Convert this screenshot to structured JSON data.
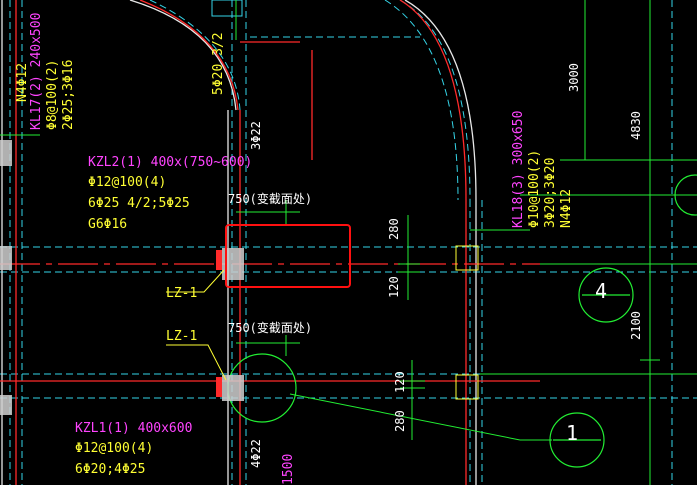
{
  "colors": {
    "background": "#000000",
    "axis_red": "#ff2a2a",
    "beam_cyan": "#35d5e8",
    "dim_green": "#22ee33",
    "label_magenta": "#ff44ff",
    "label_yellow": "#ffff33",
    "column_fill": "#cfcfcf",
    "highlight_red": "#ff1010",
    "white": "#ffffff"
  },
  "annotations": {
    "kl17": [
      "KL17(2) 240x500",
      "Φ8@100(2)",
      "2Φ25;3Φ16"
    ],
    "n4_left": "N4Φ12",
    "kzl2": [
      "KZL2(1) 400x(750~600)",
      "Φ12@100(4)",
      "6Φ25 4/2;5Φ25",
      "G6Φ16"
    ],
    "kl18": [
      "KL18(3) 300x650",
      "Φ10@100(2)",
      "3Φ20;3Φ20",
      "N4Φ12"
    ],
    "kzl1": [
      "KZL1(1) 400x600",
      "Φ12@100(4)",
      "6Φ20;4Φ25"
    ],
    "col_rebar_top": "5Φ20 3/2",
    "col_rebar_side": "3Φ22",
    "col_rebar_bottom": "4Φ22",
    "section_change_top": "750(变截面处)",
    "section_change_mid": "750(变截面处)",
    "lz1_upper": "LZ-1",
    "lz1_lower": "LZ-1",
    "dim_280_top": "280",
    "dim_120_top": "120",
    "dim_120_bottom": "120",
    "dim_280_bottom": "280",
    "dim_3000": "3000",
    "dim_4830": "4830",
    "dim_2100": "2100",
    "dim_1500": "1500",
    "axis_4": "4",
    "axis_1": "1"
  }
}
